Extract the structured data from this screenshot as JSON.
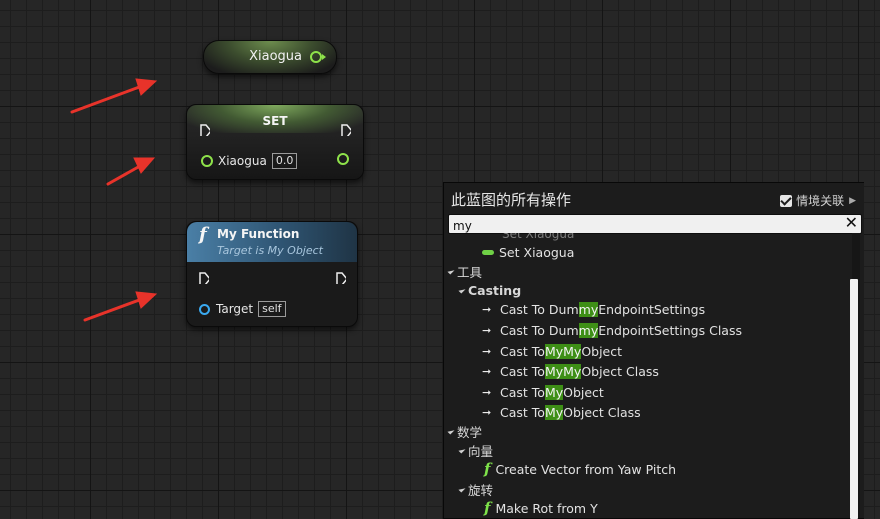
{
  "variable_node": {
    "label": "Xiaogua"
  },
  "set_node": {
    "title": "SET",
    "pin_label": "Xiaogua",
    "pin_value": "0.0"
  },
  "function_node": {
    "icon": "f",
    "title": "My Function",
    "subtitle": "Target is My Object",
    "target_label": "Target",
    "target_value": "self"
  },
  "menu": {
    "title": "此蓝图的所有操作",
    "context_label": "情境关联",
    "context_checked": true,
    "search_value": "my",
    "clipped_item": "Set Xiaogua",
    "items": {
      "set_xiaogua": "Set Xiaogua",
      "cat_tools": "工具",
      "cat_casting": "Casting",
      "cast1_pre": "Cast To Dum",
      "cast1_hl": "my",
      "cast1_post": "EndpointSettings",
      "cast2_pre": "Cast To Dum",
      "cast2_hl": "my",
      "cast2_post": "EndpointSettings Class",
      "cast3_pre": "Cast To ",
      "cast3_hl": "MyMy",
      "cast3_post": "Object",
      "cast4_pre": "Cast To ",
      "cast4_hl": "MyMy",
      "cast4_post": "Object Class",
      "cast5_pre": "Cast To ",
      "cast5_hl": "My",
      "cast5_post": "Object",
      "cast6_pre": "Cast To ",
      "cast6_hl": "My",
      "cast6_post": "Object Class",
      "cat_math": "数学",
      "cat_vector": "向量",
      "create_vector": "Create Vector from Yaw Pitch",
      "cat_rotation": "旋转",
      "make_rot": "Make Rot from Y"
    }
  },
  "colors": {
    "highlight": "#3e8f16",
    "pin_green": "#8ee24a",
    "pin_blue": "#3aa9f0",
    "arrow": "#e8332a"
  }
}
